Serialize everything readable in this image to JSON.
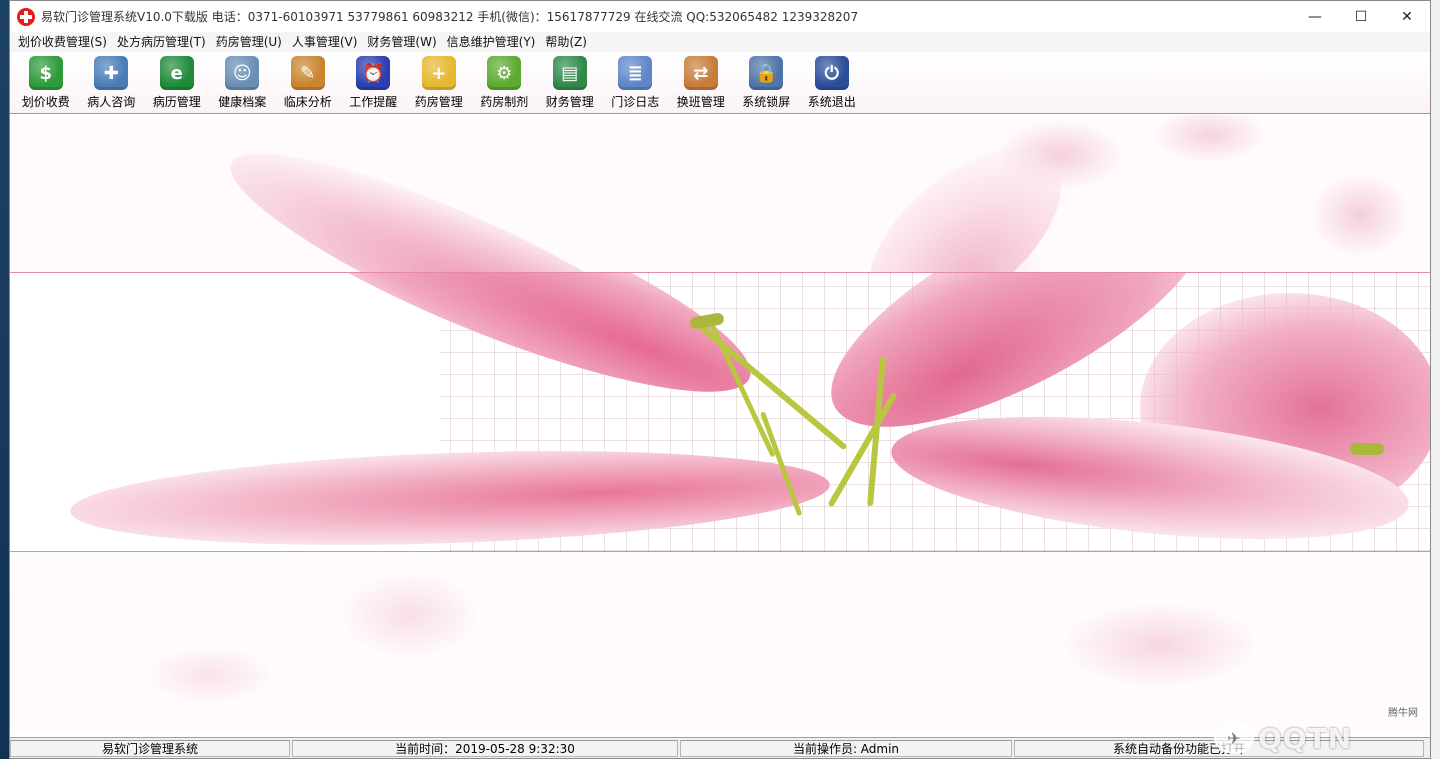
{
  "window": {
    "title": "易软门诊管理系统V10.0下载版  电话：0371-60103971 53779861 60983212 手机(微信)：15617877729  在线交流 QQ:532065482 1239328207",
    "minimize_glyph": "—",
    "maximize_glyph": "☐",
    "close_glyph": "✕"
  },
  "menu": [
    {
      "label": "划价收费管理(S)"
    },
    {
      "label": "处方病历管理(T)"
    },
    {
      "label": "药房管理(U)"
    },
    {
      "label": "人事管理(V)"
    },
    {
      "label": "财务管理(W)"
    },
    {
      "label": "信息维护管理(Y)"
    },
    {
      "label": "帮助(Z)"
    }
  ],
  "toolbar": [
    {
      "label": "划价收费",
      "icon": "money-calculator-icon",
      "color": "#2e9a3a",
      "glyph": "$"
    },
    {
      "label": "病人咨询",
      "icon": "doctor-icon",
      "color": "#4a7db8",
      "glyph": "✚"
    },
    {
      "label": "病历管理",
      "icon": "green-book-icon",
      "color": "#1f8a3a",
      "glyph": "e"
    },
    {
      "label": "健康档案",
      "icon": "person-file-icon",
      "color": "#6a8fb5",
      "glyph": "☺"
    },
    {
      "label": "临床分析",
      "icon": "clipboard-icon",
      "color": "#c9852f",
      "glyph": "✎"
    },
    {
      "label": "工作提醒",
      "icon": "alarm-clock-icon",
      "color": "#2b3fb0",
      "glyph": "⏰"
    },
    {
      "label": "药房管理",
      "icon": "folder-add-icon",
      "color": "#e6b830",
      "glyph": "+"
    },
    {
      "label": "药房制剂",
      "icon": "gear-icon",
      "color": "#5caa2f",
      "glyph": "⚙"
    },
    {
      "label": "财务管理",
      "icon": "green-ledger-icon",
      "color": "#2f8a4a",
      "glyph": "▤"
    },
    {
      "label": "门诊日志",
      "icon": "documents-icon",
      "color": "#5f86c8",
      "glyph": "≣"
    },
    {
      "label": "换班管理",
      "icon": "handshake-icon",
      "color": "#c77d3a",
      "glyph": "⇄"
    },
    {
      "label": "系统锁屏",
      "icon": "user-lock-icon",
      "color": "#4f74a8",
      "glyph": "🔒"
    },
    {
      "label": "系统退出",
      "icon": "power-icon",
      "color": "#2c4f9a",
      "glyph": "⏻"
    }
  ],
  "status": {
    "app_name": "易软门诊管理系统",
    "time": "当前时间：2019-05-28 9:32:30",
    "operator": "当前操作员: Admin",
    "backup": "系统自动备份功能已打开"
  },
  "watermark": {
    "site": "腾牛网",
    "text": "QQTN"
  }
}
